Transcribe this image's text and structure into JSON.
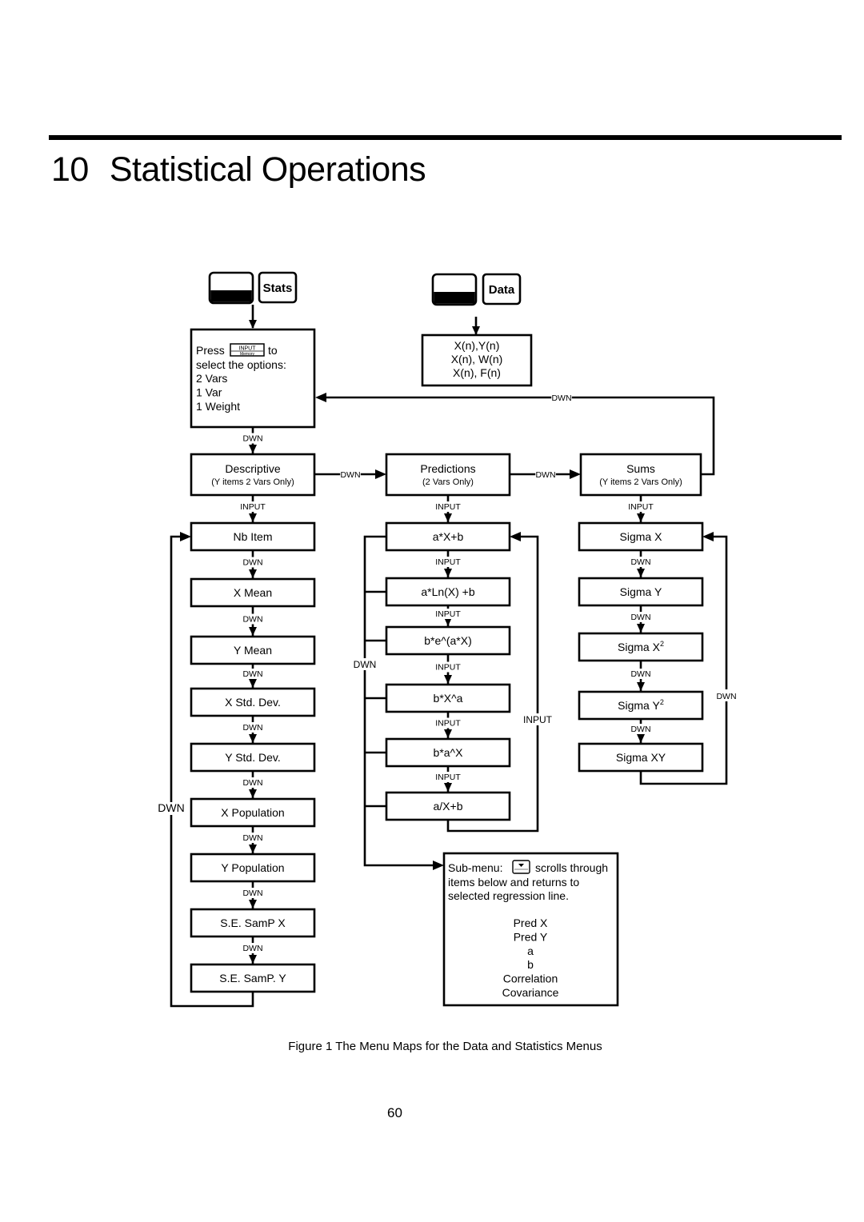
{
  "header": {
    "chapter_number": "10",
    "chapter_title": "Statistical Operations"
  },
  "keys": {
    "stats_key": {
      "label": "Stats",
      "icon": "shift-key-icon"
    },
    "data_key": {
      "label": "Data",
      "icon": "shift-key-icon"
    },
    "input_key": {
      "top": "INPUT",
      "bottom": "Memory"
    }
  },
  "stats_menu": {
    "press": "Press",
    "to": "to",
    "line2": "select the options:",
    "options": [
      "2 Vars",
      "1 Var",
      "1 Weight"
    ]
  },
  "data_menu": {
    "lines": [
      "X(n),Y(n)",
      "X(n), W(n)",
      "X(n), F(n)"
    ]
  },
  "categories": [
    {
      "title": "Descriptive",
      "subtitle": "(Y items 2 Vars Only)"
    },
    {
      "title": "Predictions",
      "subtitle": "(2 Vars Only)"
    },
    {
      "title": "Sums",
      "subtitle": "(Y items 2 Vars Only)"
    }
  ],
  "descriptive_items": [
    "Nb Item",
    "X Mean",
    "Y Mean",
    "X Std. Dev.",
    "Y Std. Dev.",
    "X Population",
    "Y Population",
    "S.E. SamP X",
    "S.E. SamP. Y"
  ],
  "prediction_items": [
    "a*X+b",
    "a*Ln(X) +b",
    "b*e^(a*X)",
    "b*X^a",
    "b*a^X",
    "a/X+b"
  ],
  "sums_items": [
    {
      "base": "Sigma X",
      "sup": ""
    },
    {
      "base": "Sigma Y",
      "sup": ""
    },
    {
      "base": "Sigma X",
      "sup": "2"
    },
    {
      "base": "Sigma Y",
      "sup": "2"
    },
    {
      "base": "Sigma XY",
      "sup": ""
    }
  ],
  "submenu": {
    "label": "Sub-menu:",
    "desc1": "scrolls through",
    "desc2": "items below and returns to",
    "desc3": "selected regression line.",
    "items": [
      "Pred X",
      "Pred Y",
      "a",
      "b",
      "Correlation",
      "Covariance"
    ]
  },
  "connector_labels": {
    "down": "DWN",
    "input": "INPUT"
  },
  "caption": "Figure 1 The Menu Maps for the Data and Statistics Menus",
  "page_number": "60"
}
